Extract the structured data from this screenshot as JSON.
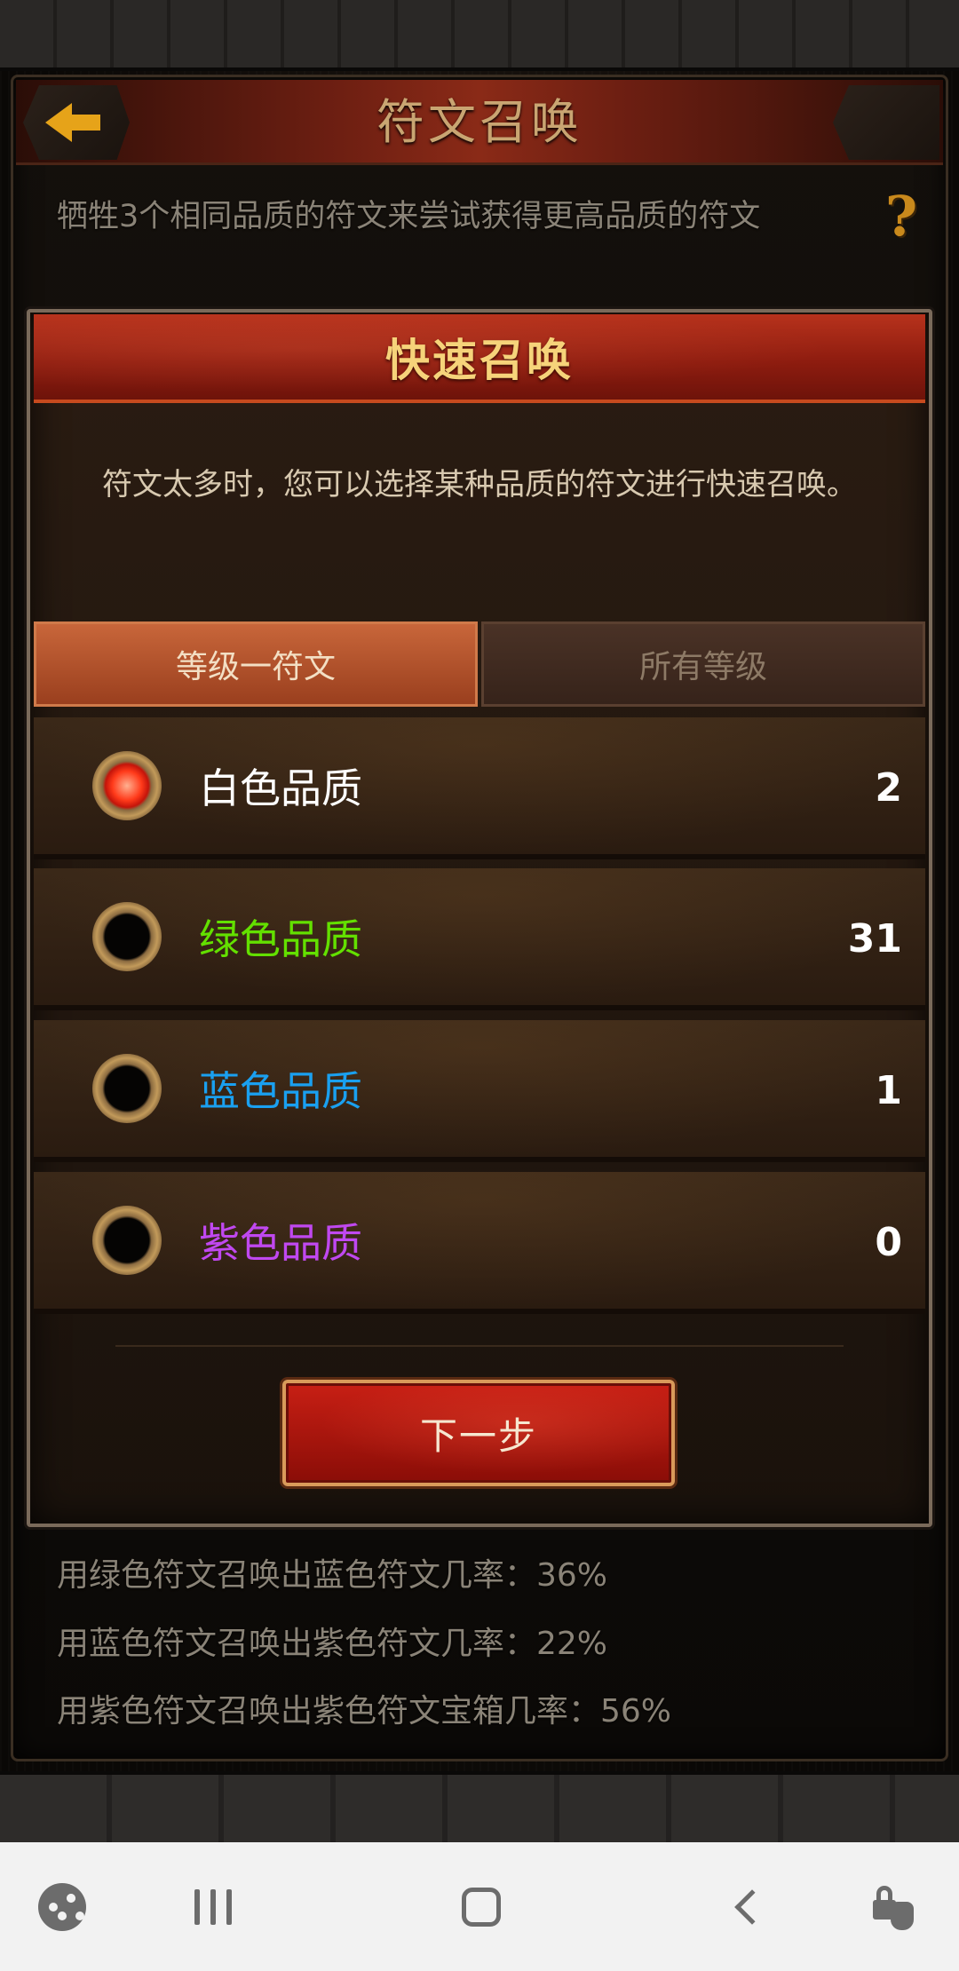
{
  "header": {
    "title": "符文召唤",
    "back_icon": "back-arrow-icon",
    "help_icon": "question-mark-icon",
    "help_symbol": "?"
  },
  "description": "牺牲3个相同品质的符文来尝试获得更高品质的符文",
  "modal": {
    "title": "快速召唤",
    "message": "符文太多时，您可以选择某种品质的符文进行快速召唤。",
    "tabs": [
      {
        "label": "等级一符文",
        "active": true
      },
      {
        "label": "所有等级",
        "active": false
      }
    ],
    "options": [
      {
        "label": "白色品质",
        "count": "2",
        "selected": true,
        "color": "#ffffff"
      },
      {
        "label": "绿色品质",
        "count": "31",
        "selected": false,
        "color": "#63e000"
      },
      {
        "label": "蓝色品质",
        "count": "1",
        "selected": false,
        "color": "#1aa0f0"
      },
      {
        "label": "紫色品质",
        "count": "0",
        "selected": false,
        "color": "#c048f0"
      }
    ],
    "next_button": "下一步"
  },
  "rates": [
    "用绿色符文召唤出蓝色符文几率：36%",
    "用蓝色符文召唤出紫色符文几率：22%",
    "用紫色符文召唤出紫色符文宝箱几率：56%"
  ],
  "navbar": {
    "icons": [
      "game-launcher-icon",
      "recent-apps-icon",
      "home-icon",
      "back-icon",
      "touch-lock-icon"
    ]
  },
  "colors": {
    "accent_red": "#8e1c0f",
    "title_gold": "#c9a572",
    "header_gold": "#f6d37a",
    "help_orange": "#c9891c"
  }
}
